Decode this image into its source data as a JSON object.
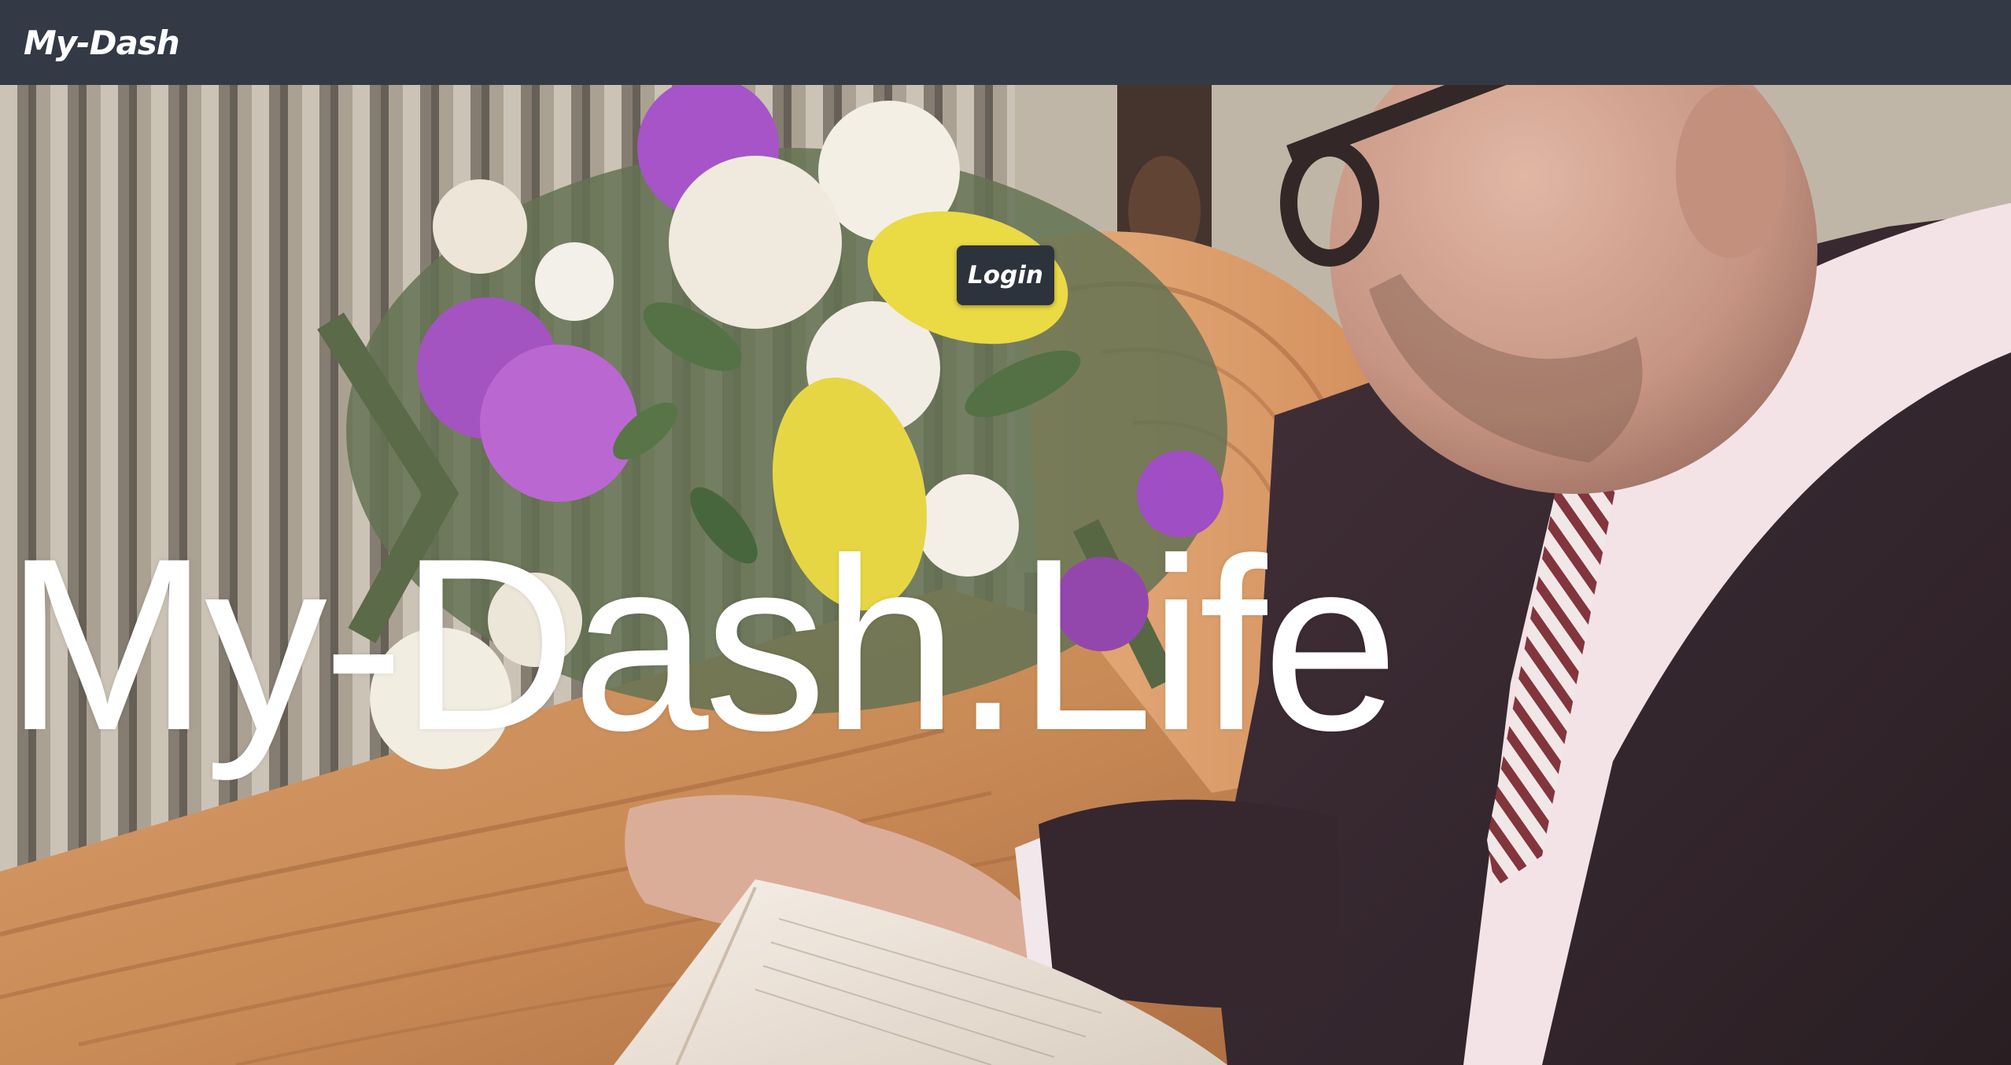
{
  "navbar": {
    "brand": "My-Dash"
  },
  "hero": {
    "login_label": "Login",
    "title": "My-Dash.Life",
    "background_photo": "man-reading-book-at-casket-with-flowers"
  },
  "colors": {
    "navbar_bg": "#333a45",
    "button_bg": "#2d333c",
    "text": "#ffffff"
  }
}
